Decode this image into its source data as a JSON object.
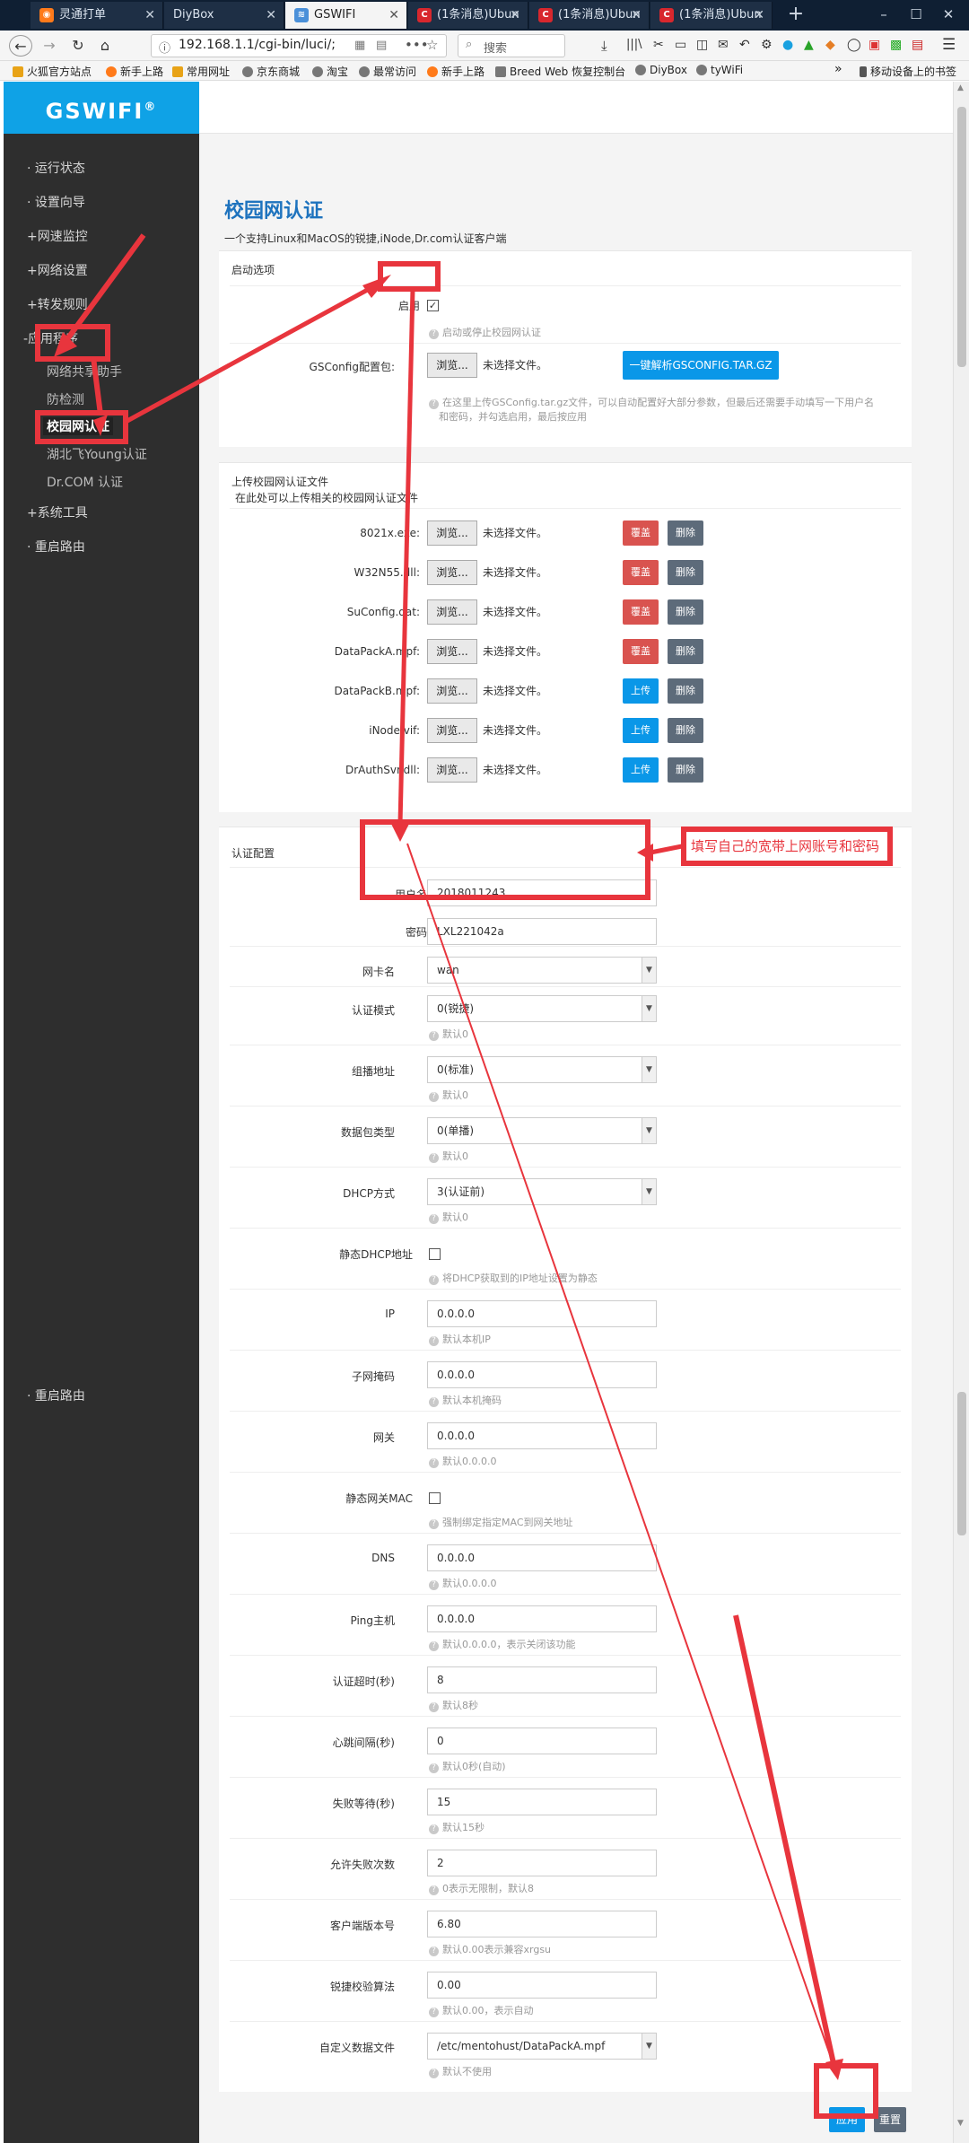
{
  "browser": {
    "tabs": [
      {
        "title": "灵通打单",
        "icon": "fox"
      },
      {
        "title": "DiyBox",
        "icon": ""
      },
      {
        "title": "GSWIFI",
        "icon": "router"
      },
      {
        "title": "(1条消息)Ubun",
        "icon": "csdn-c"
      },
      {
        "title": "(1条消息)Ubun",
        "icon": "csdn-c"
      },
      {
        "title": "(1条消息)Ubun",
        "icon": "csdn-c"
      }
    ],
    "url": "192.168.1.1/cgi-bin/luci/;",
    "search_placeholder": "搜索",
    "bookmarks": [
      "火狐官方站点",
      "新手上路",
      "常用网址",
      "京东商城",
      "淘宝",
      "最常访问",
      "新手上路",
      "Breed Web 恢复控制台",
      "DiyBox",
      "tyWiFi"
    ],
    "mobile_bookmarks": "移动设备上的书签",
    "more": "»"
  },
  "sidebar": {
    "logo": "GSWIFI",
    "logo_mark": "®",
    "items": [
      {
        "label": "运行状态",
        "prefix": "·"
      },
      {
        "label": "设置向导",
        "prefix": "·"
      },
      {
        "label": "网速监控",
        "prefix": "+"
      },
      {
        "label": "网络设置",
        "prefix": "+"
      },
      {
        "label": "转发规则",
        "prefix": "+"
      },
      {
        "label": "应用程序",
        "prefix": "-"
      },
      {
        "label": "网络共享助手",
        "prefix": ""
      },
      {
        "label": "防检测",
        "prefix": ""
      },
      {
        "label": "校园网认证",
        "prefix": ""
      },
      {
        "label": "湖北飞Young认证",
        "prefix": ""
      },
      {
        "label": "Dr.COM 认证",
        "prefix": ""
      },
      {
        "label": "系统工具",
        "prefix": "+"
      },
      {
        "label": "重启路由",
        "prefix": "·"
      },
      {
        "label": "重启路由",
        "prefix": "·"
      }
    ]
  },
  "page": {
    "title": "校园网认证",
    "description": "一个支持Linux和MacOS的锐捷,iNode,Dr.com认证客户端"
  },
  "startup": {
    "section_title": "启动选项",
    "enable_label": "启用",
    "enable_checked": true,
    "enable_hint": "启动或停止校园网认证",
    "gsconfig_label": "GSConfig配置包:",
    "browse": "浏览...",
    "no_file": "未选择文件。",
    "parse_button": "一键解析GSCONFIG.TAR.GZ",
    "gsconfig_hint_1": "在这里上传GSConfig.tar.gz文件，可以自动配置好大部分参数，但最后还需要手动填写一下用户名",
    "gsconfig_hint_2": "和密码，并勾选启用，最后按应用"
  },
  "upload": {
    "section_title": "上传校园网认证文件",
    "subtitle": "在此处可以上传相关的校园网认证文件",
    "browse": "浏览...",
    "no_file": "未选择文件。",
    "delete": "删除",
    "files": [
      {
        "name": "8021x.exe:",
        "action": "覆盖"
      },
      {
        "name": "W32N55.dll:",
        "action": "覆盖"
      },
      {
        "name": "SuConfig.dat:",
        "action": "覆盖"
      },
      {
        "name": "DataPackA.mpf:",
        "action": "覆盖"
      },
      {
        "name": "DataPackB.mpf:",
        "action": "上传"
      },
      {
        "name": "iNode.vif:",
        "action": "上传"
      },
      {
        "name": "DrAuthSvr.dll:",
        "action": "上传"
      }
    ]
  },
  "auth": {
    "section_title": "认证配置",
    "username_label": "用户名",
    "username": "2018011243",
    "password_label": "密码",
    "password": "LXL221042a",
    "nic_label": "网卡名",
    "nic": "wan",
    "mode_label": "认证模式",
    "mode": "0(锐捷)",
    "mode_hint": "默认0",
    "mcast_label": "组播地址",
    "mcast": "0(标准)",
    "mcast_hint": "默认0",
    "pkt_label": "数据包类型",
    "pkt": "0(单播)",
    "pkt_hint": "默认0",
    "dhcp_label": "DHCP方式",
    "dhcp": "3(认证前)",
    "dhcp_hint": "默认0",
    "static_dhcp_label": "静态DHCP地址",
    "static_dhcp_hint": "将DHCP获取到的IP地址设置为静态",
    "ip_label": "IP",
    "ip": "0.0.0.0",
    "ip_hint": "默认本机IP",
    "mask_label": "子网掩码",
    "mask": "0.0.0.0",
    "mask_hint": "默认本机掩码",
    "gw_label": "网关",
    "gw": "0.0.0.0",
    "gw_hint": "默认0.0.0.0",
    "static_mac_label": "静态网关MAC",
    "static_mac_hint": "强制绑定指定MAC到网关地址",
    "dns_label": "DNS",
    "dns": "0.0.0.0",
    "dns_hint": "默认0.0.0.0",
    "ping_label": "Ping主机",
    "ping": "0.0.0.0",
    "ping_hint": "默认0.0.0.0，表示关闭该功能",
    "timeout_label": "认证超时(秒)",
    "timeout": "8",
    "timeout_hint": "默认8秒",
    "heartbeat_label": "心跳间隔(秒)",
    "heartbeat": "0",
    "heartbeat_hint": "默认0秒(自动)",
    "fail_wait_label": "失败等待(秒)",
    "fail_wait": "15",
    "fail_wait_hint": "默认15秒",
    "fail_count_label": "允许失败次数",
    "fail_count": "2",
    "fail_count_hint": "0表示无限制，默认8",
    "version_label": "客户端版本号",
    "version": "6.80",
    "version_hint": "默认0.00表示兼容xrgsu",
    "checksum_label": "锐捷校验算法",
    "checksum": "0.00",
    "checksum_hint": "默认0.00，表示自动",
    "datafile_label": "自定义数据文件",
    "datafile": "/etc/mentohust/DataPackA.mpf",
    "datafile_hint": "默认不使用"
  },
  "footer": {
    "apply": "应用",
    "reset": "重置"
  },
  "annotation": {
    "callout": "填写自己的宽带上网账号和密码",
    "color": "#e8353d"
  }
}
